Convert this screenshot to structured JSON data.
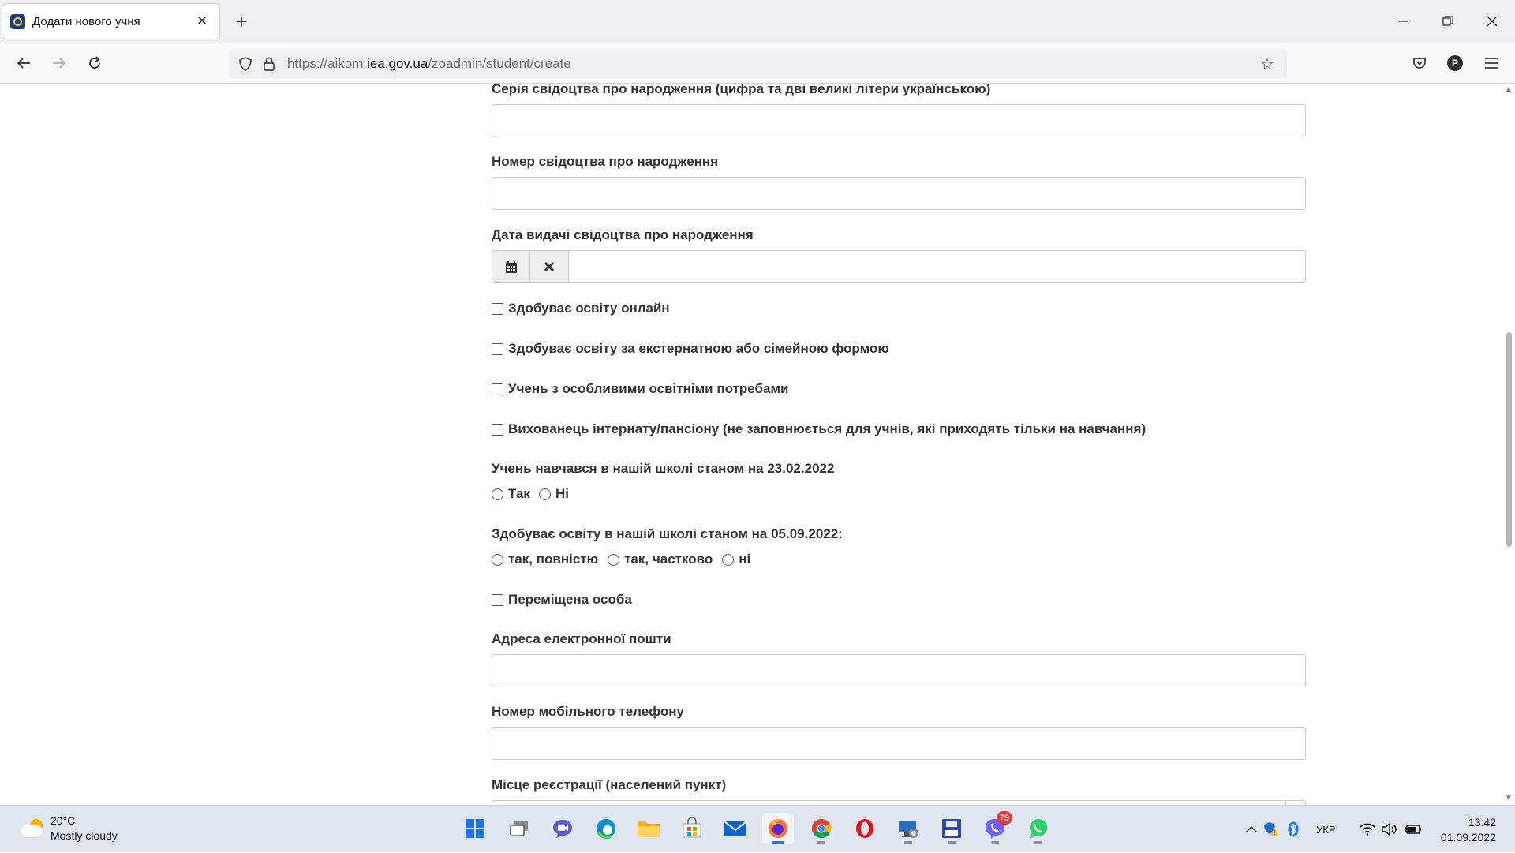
{
  "browser": {
    "tab_title": "Додати нового учня",
    "url_prefix": "https://aikom.",
    "url_domain": "iea.gov.ua",
    "url_path": "/zoadmin/student/create",
    "profile_initial": "P"
  },
  "form": {
    "birth_cert_series_label": "Серія свідоцтва про народження (цифра та дві великі літери українською)",
    "birth_cert_number_label": "Номер свідоцтва про народження",
    "birth_cert_date_label": "Дата видачі свідоцтва про народження",
    "checkbox_online": "Здобуває освіту онлайн",
    "checkbox_external": "Здобуває освіту за екстернатною або сімейною формою",
    "checkbox_special_needs": "Учень з особливими освітніми потребами",
    "checkbox_boarding": "Вихованець інтернату/пансіону (не заповнюється для учнів, які приходять тільки на навчання)",
    "studied_q_label": "Учень навчався в нашій школі станом на 23.02.2022",
    "studied_options": [
      "Так",
      "Ні"
    ],
    "studying_q_label": "Здобуває освіту в нашій школі станом на 05.09.2022:",
    "studying_options": [
      "так, повністю",
      "так, частково",
      "ні"
    ],
    "checkbox_displaced": "Переміщена особа",
    "email_label": "Адреса електронної пошти",
    "phone_label": "Номер мобільного телефону",
    "registration_label": "Місце реєстрації (населений пункт)"
  },
  "taskbar": {
    "weather_temp": "20°C",
    "weather_desc": "Mostly cloudy",
    "viber_badge": "79",
    "language": "УКР",
    "time": "13:42",
    "date": "01.09.2022"
  }
}
